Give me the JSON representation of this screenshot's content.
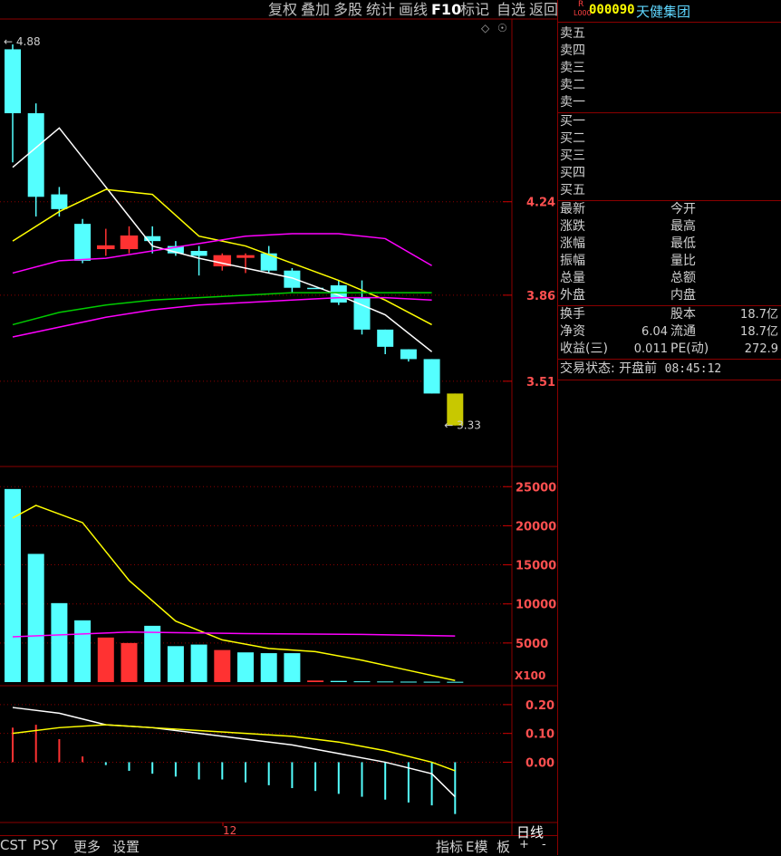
{
  "toolbar": {
    "items": [
      "复权",
      "叠加",
      "多股",
      "统计",
      "画线",
      "F10",
      "标记",
      "自选",
      "返回"
    ]
  },
  "stock": {
    "r_badge": "R",
    "level_badge": "L000",
    "code": "000090",
    "name": "天健集团"
  },
  "order_book": {
    "sell": [
      "卖五",
      "卖四",
      "卖三",
      "卖二",
      "卖一"
    ],
    "buy": [
      "买一",
      "买二",
      "买三",
      "买四",
      "买五"
    ]
  },
  "quote": {
    "left_labels": [
      "最新",
      "涨跌",
      "涨幅",
      "振幅",
      "总量",
      "外盘"
    ],
    "right_labels": [
      "今开",
      "最高",
      "最低",
      "量比",
      "总额",
      "内盘"
    ]
  },
  "stats": {
    "turnover_label": "换手",
    "share_capital_label": "股本",
    "share_capital_value": "18.7亿",
    "net_assets_label": "净资",
    "net_assets_value": "6.04",
    "float_label": "流通",
    "float_value": "18.7亿",
    "eps_label": "收益(三)",
    "eps_value": "0.011",
    "pe_label": "PE(动)",
    "pe_value": "272.9"
  },
  "trade_status": {
    "label": "交易状态: 开盘前",
    "time": "08:45:12"
  },
  "bottom": {
    "tabs": [
      "CST",
      "PSY",
      "更多",
      "设置"
    ],
    "right_tabs": [
      "指标",
      "E模",
      "板"
    ],
    "period": "日线",
    "plus": "+",
    "minus": "-"
  },
  "chart_data": [
    {
      "type": "candlestick",
      "title": "",
      "y_ticks": [
        4.24,
        3.86,
        3.51
      ],
      "ylim": [
        3.2,
        4.95
      ],
      "max_label": "4.88",
      "min_label": "3.33",
      "candles": [
        {
          "o": 4.6,
          "h": 4.88,
          "l": 4.4,
          "c": 4.86,
          "color": "cyan"
        },
        {
          "o": 4.6,
          "h": 4.64,
          "l": 4.18,
          "c": 4.26,
          "color": "cyan"
        },
        {
          "o": 4.27,
          "h": 4.3,
          "l": 4.18,
          "c": 4.21,
          "color": "cyan"
        },
        {
          "o": 4.15,
          "h": 4.17,
          "l": 3.99,
          "c": 4.0,
          "color": "cyan"
        },
        {
          "o": 4.05,
          "h": 4.13,
          "l": 4.02,
          "c": 4.06,
          "color": "red"
        },
        {
          "o": 4.05,
          "h": 4.14,
          "l": 4.03,
          "c": 4.1,
          "color": "red"
        },
        {
          "o": 4.1,
          "h": 4.14,
          "l": 4.03,
          "c": 4.08,
          "color": "cyan"
        },
        {
          "o": 4.06,
          "h": 4.08,
          "l": 4.02,
          "c": 4.03,
          "color": "cyan"
        },
        {
          "o": 4.04,
          "h": 4.06,
          "l": 3.94,
          "c": 4.02,
          "color": "cyan"
        },
        {
          "o": 3.98,
          "h": 4.03,
          "l": 3.96,
          "c": 4.02,
          "color": "red"
        },
        {
          "o": 4.02,
          "h": 4.03,
          "l": 3.95,
          "c": 4.02,
          "color": "red"
        },
        {
          "o": 4.03,
          "h": 4.06,
          "l": 3.95,
          "c": 3.96,
          "color": "cyan"
        },
        {
          "o": 3.96,
          "h": 3.97,
          "l": 3.87,
          "c": 3.89,
          "color": "cyan"
        },
        {
          "o": 3.89,
          "h": 3.89,
          "l": 3.89,
          "c": 3.89,
          "color": "cyan"
        },
        {
          "o": 3.9,
          "h": 3.92,
          "l": 3.82,
          "c": 3.83,
          "color": "cyan"
        },
        {
          "o": 3.85,
          "h": 3.92,
          "l": 3.7,
          "c": 3.72,
          "color": "cyan"
        },
        {
          "o": 3.72,
          "h": 3.72,
          "l": 3.62,
          "c": 3.65,
          "color": "cyan"
        },
        {
          "o": 3.64,
          "h": 3.64,
          "l": 3.59,
          "c": 3.6,
          "color": "cyan"
        },
        {
          "o": 3.6,
          "h": 3.6,
          "l": 3.46,
          "c": 3.46,
          "color": "cyan"
        },
        {
          "o": 3.33,
          "h": 3.46,
          "l": 3.33,
          "c": 3.46,
          "color": "olive"
        }
      ],
      "ma_lines": [
        {
          "color": "#ffffff",
          "points": [
            [
              0,
              4.38
            ],
            [
              2,
              4.54
            ],
            [
              4,
              4.3
            ],
            [
              6,
              4.06
            ],
            [
              8,
              4.01
            ],
            [
              10,
              3.97
            ],
            [
              12,
              3.93
            ],
            [
              14,
              3.86
            ],
            [
              16,
              3.78
            ],
            [
              18,
              3.63
            ]
          ]
        },
        {
          "color": "#ffff00",
          "points": [
            [
              0,
              4.08
            ],
            [
              2,
              4.2
            ],
            [
              4,
              4.29
            ],
            [
              6,
              4.27
            ],
            [
              8,
              4.1
            ],
            [
              10,
              4.06
            ],
            [
              12,
              3.99
            ],
            [
              14,
              3.92
            ],
            [
              16,
              3.84
            ],
            [
              18,
              3.74
            ]
          ]
        },
        {
          "color": "#ff00ff",
          "points": [
            [
              0,
              3.95
            ],
            [
              2,
              4.0
            ],
            [
              4,
              4.01
            ],
            [
              6,
              4.04
            ],
            [
              8,
              4.07
            ],
            [
              10,
              4.1
            ],
            [
              12,
              4.11
            ],
            [
              14,
              4.11
            ],
            [
              16,
              4.09
            ],
            [
              18,
              3.98
            ]
          ]
        },
        {
          "color": "#00cc00",
          "points": [
            [
              0,
              3.74
            ],
            [
              2,
              3.79
            ],
            [
              4,
              3.82
            ],
            [
              6,
              3.84
            ],
            [
              8,
              3.85
            ],
            [
              10,
              3.86
            ],
            [
              12,
              3.87
            ],
            [
              14,
              3.87
            ],
            [
              16,
              3.87
            ],
            [
              18,
              3.87
            ]
          ]
        },
        {
          "color": "#ff00ff",
          "points": [
            [
              0,
              3.69
            ],
            [
              2,
              3.73
            ],
            [
              4,
              3.77
            ],
            [
              6,
              3.8
            ],
            [
              8,
              3.82
            ],
            [
              10,
              3.83
            ],
            [
              12,
              3.84
            ],
            [
              14,
              3.85
            ],
            [
              16,
              3.85
            ],
            [
              18,
              3.84
            ]
          ]
        }
      ]
    },
    {
      "type": "bar",
      "title": "",
      "y_ticks": [
        25000,
        20000,
        15000,
        10000,
        5000
      ],
      "unit_label": "X100",
      "ylim": [
        0,
        27000
      ],
      "values": [
        24700,
        16400,
        10100,
        7900,
        5700,
        5000,
        7200,
        4600,
        4800,
        4100,
        3800,
        3700,
        3700,
        200,
        150,
        100,
        80,
        60,
        50,
        40
      ],
      "colors": [
        "cyan",
        "cyan",
        "cyan",
        "cyan",
        "red",
        "red",
        "cyan",
        "cyan",
        "cyan",
        "red",
        "cyan",
        "cyan",
        "cyan",
        "red",
        "cyan",
        "cyan",
        "cyan",
        "cyan",
        "cyan",
        "cyan"
      ],
      "ma_lines": [
        {
          "color": "#ffff00",
          "points": [
            [
              0,
              21000
            ],
            [
              1,
              22600
            ],
            [
              3,
              20400
            ],
            [
              5,
              13000
            ],
            [
              7,
              7800
            ],
            [
              9,
              5400
            ],
            [
              11,
              4300
            ],
            [
              13,
              3900
            ],
            [
              15,
              2800
            ],
            [
              17,
              1500
            ],
            [
              19,
              200
            ]
          ]
        },
        {
          "color": "#ff00ff",
          "points": [
            [
              0,
              5800
            ],
            [
              5,
              6400
            ],
            [
              10,
              6200
            ],
            [
              15,
              6100
            ],
            [
              19,
              5900
            ]
          ]
        }
      ]
    },
    {
      "type": "bar",
      "title": "",
      "y_ticks": [
        0.2,
        0.1,
        0.0
      ],
      "ylim": [
        -0.2,
        0.25
      ],
      "values": [
        0.12,
        0.13,
        0.08,
        0.02,
        -0.01,
        -0.03,
        -0.04,
        -0.05,
        -0.06,
        -0.06,
        -0.07,
        -0.08,
        -0.09,
        -0.1,
        -0.11,
        -0.12,
        -0.13,
        -0.14,
        -0.15,
        -0.18
      ],
      "lines": [
        {
          "color": "#ffffff",
          "points": [
            [
              0,
              0.19
            ],
            [
              2,
              0.17
            ],
            [
              4,
              0.13
            ],
            [
              6,
              0.12
            ],
            [
              8,
              0.1
            ],
            [
              10,
              0.08
            ],
            [
              12,
              0.06
            ],
            [
              14,
              0.03
            ],
            [
              16,
              0.0
            ],
            [
              18,
              -0.04
            ],
            [
              19,
              -0.12
            ]
          ]
        },
        {
          "color": "#ffff00",
          "points": [
            [
              0,
              0.1
            ],
            [
              2,
              0.12
            ],
            [
              4,
              0.13
            ],
            [
              6,
              0.12
            ],
            [
              8,
              0.11
            ],
            [
              10,
              0.1
            ],
            [
              12,
              0.09
            ],
            [
              14,
              0.07
            ],
            [
              16,
              0.04
            ],
            [
              18,
              0.0
            ],
            [
              19,
              -0.03
            ]
          ]
        }
      ],
      "x_tick_label": "12"
    }
  ]
}
